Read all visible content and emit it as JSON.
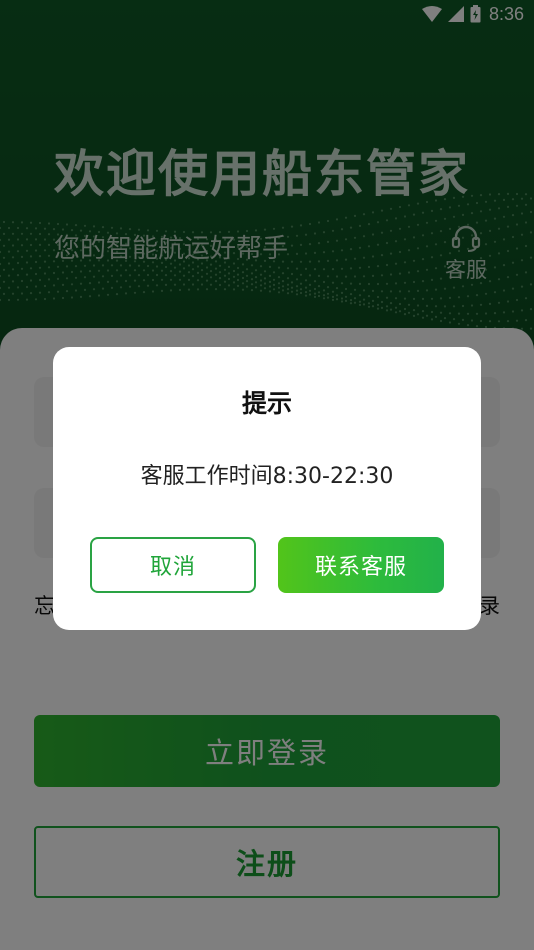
{
  "status_bar": {
    "time": "8:36"
  },
  "hero": {
    "title": "欢迎使用船东管家",
    "subtitle": "您的智能航运好帮手",
    "service_label": "客服"
  },
  "form": {
    "forgot_prefix": "忘",
    "login_suffix": "录"
  },
  "buttons": {
    "login_label": "立即登录",
    "register_label": "注册"
  },
  "dialog": {
    "title": "提示",
    "message": "客服工作时间8:30-22:30",
    "cancel_label": "取消",
    "confirm_label": "联系客服"
  },
  "colors": {
    "brand_green": "#20a53a",
    "header_green": "#0f5a26"
  }
}
